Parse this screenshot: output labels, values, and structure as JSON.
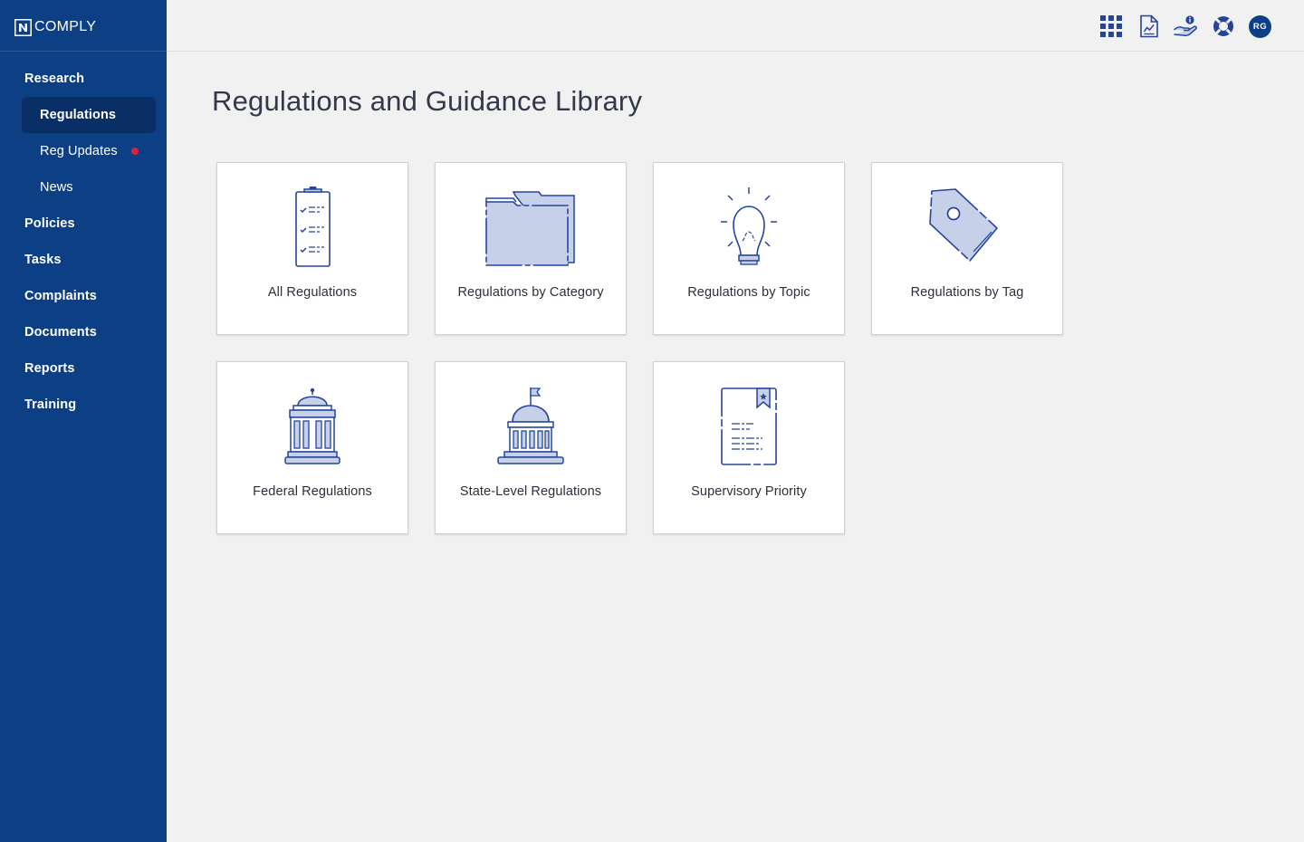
{
  "brand": {
    "name": "COMPLY",
    "logo_letter": "N"
  },
  "sidebar": {
    "items": [
      {
        "label": "Research",
        "type": "section"
      },
      {
        "label": "Regulations",
        "type": "sub",
        "active": true
      },
      {
        "label": "Reg Updates",
        "type": "sub",
        "badge": "red-dot"
      },
      {
        "label": "News",
        "type": "sub"
      },
      {
        "label": "Policies",
        "type": "section"
      },
      {
        "label": "Tasks",
        "type": "section"
      },
      {
        "label": "Complaints",
        "type": "section"
      },
      {
        "label": "Documents",
        "type": "section"
      },
      {
        "label": "Reports",
        "type": "section"
      },
      {
        "label": "Training",
        "type": "section"
      }
    ]
  },
  "header": {
    "icons": [
      "apps-grid-icon",
      "document-chart-icon",
      "hand-info-icon",
      "lifebuoy-icon"
    ],
    "avatar_initials": "RG"
  },
  "main": {
    "title": "Regulations and Guidance Library",
    "cards": [
      {
        "label": "All Regulations",
        "icon": "clipboard-checklist-icon"
      },
      {
        "label": "Regulations by Category",
        "icon": "folder-icon"
      },
      {
        "label": "Regulations by Topic",
        "icon": "lightbulb-icon"
      },
      {
        "label": "Regulations by Tag",
        "icon": "tag-icon"
      },
      {
        "label": "Federal Regulations",
        "icon": "capitol-building-icon"
      },
      {
        "label": "State-Level Regulations",
        "icon": "state-building-icon"
      },
      {
        "label": "Supervisory Priority",
        "icon": "bookmark-document-icon"
      }
    ]
  },
  "colors": {
    "sidebar_bg": "#0d3f85",
    "sidebar_active_bg": "#0a2f66",
    "icon_stroke": "#24459a",
    "icon_fill": "#c6d0e8",
    "badge_red": "#d9223c",
    "page_bg": "#f1f1f1"
  }
}
